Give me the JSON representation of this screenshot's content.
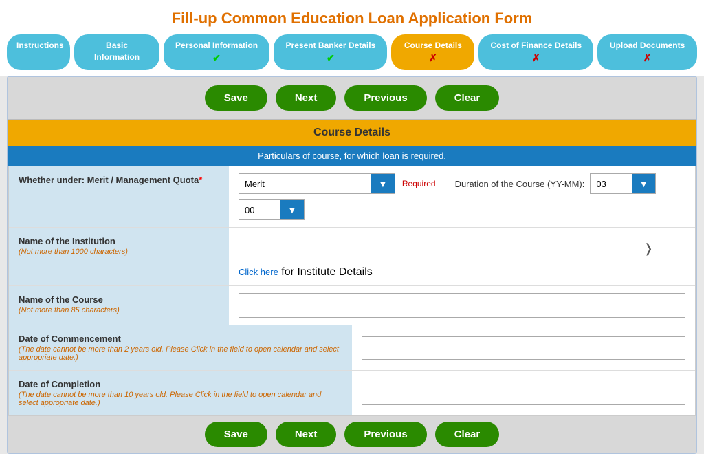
{
  "page": {
    "title": "Fill-up Common Education Loan Application Form"
  },
  "nav": {
    "tabs": [
      {
        "label": "Instructions",
        "status": "none",
        "active": false
      },
      {
        "label": "Basic Information",
        "status": "none",
        "active": false
      },
      {
        "label": "Personal Information",
        "status": "check",
        "active": false
      },
      {
        "label": "Present Banker Details",
        "status": "check",
        "active": false
      },
      {
        "label": "Course Details",
        "status": "cross",
        "active": true
      },
      {
        "label": "Cost of Finance Details",
        "status": "cross",
        "active": false
      },
      {
        "label": "Upload Documents",
        "status": "cross",
        "active": false
      }
    ]
  },
  "toolbar": {
    "save_label": "Save",
    "next_label": "Next",
    "previous_label": "Previous",
    "clear_label": "Clear"
  },
  "section": {
    "header": "Course Details",
    "subheader": "Particulars of course, for which loan is required."
  },
  "form": {
    "merit_label": "Whether under: Merit / Management Quota",
    "merit_required": "*",
    "merit_value": "Merit",
    "required_msg": "Required",
    "duration_label": "Duration of the Course (YY-MM):",
    "duration_yy": "03",
    "duration_mm": "00",
    "institution_label": "Name of the Institution",
    "institution_note": "(Not more than 1000 characters)",
    "click_here_text": "Click here",
    "click_here_suffix": " for Institute Details",
    "course_label": "Name of the Course",
    "course_note": "(Not more than 85 characters)",
    "commencement_label": "Date of Commencement",
    "commencement_note": "(The date cannot be more than 2 years old. Please Click in the field to open calendar and select appropriate date.)",
    "completion_label": "Date of Completion",
    "completion_note": "(The date cannot be more than 10 years old. Please Click in the field to open calendar and select appropriate date.)"
  }
}
